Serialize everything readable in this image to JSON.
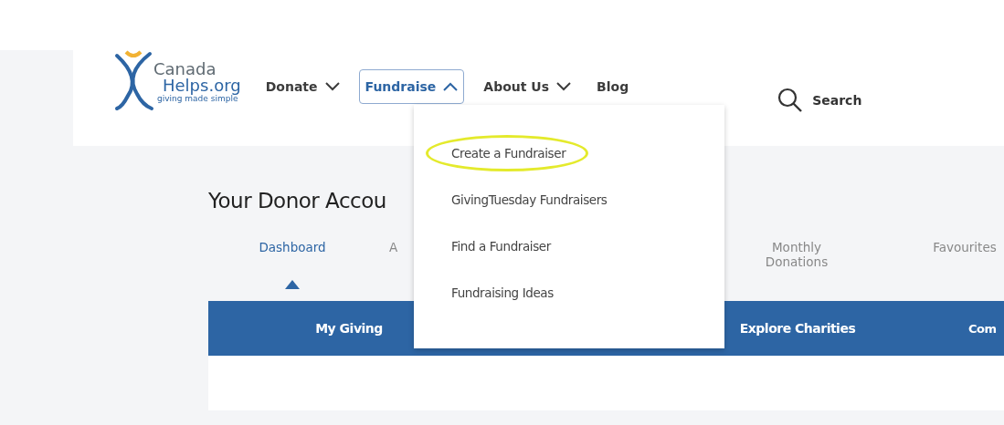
{
  "logo": {
    "line_1": "Canada",
    "line_2": "Helps.org",
    "tagline": "giving made simple"
  },
  "nav": [
    {
      "label": "Donate",
      "expanded": false,
      "has_menu": true
    },
    {
      "label": "Fundraise",
      "expanded": true,
      "has_menu": true
    },
    {
      "label": "About Us",
      "expanded": false,
      "has_menu": true
    },
    {
      "label": "Blog",
      "expanded": false,
      "has_menu": false
    }
  ],
  "search": {
    "label": "Search"
  },
  "dropdown": {
    "items": [
      {
        "label": "Create a Fundraiser",
        "circled": true
      },
      {
        "label": "GivingTuesday Fundraisers",
        "circled": false
      },
      {
        "label": "Find a Fundraiser",
        "circled": false
      },
      {
        "label": "Fundraising Ideas",
        "circled": false
      }
    ]
  },
  "page_title": "Your Donor Accou",
  "tabs": [
    {
      "label": "Dashboard",
      "selected": true
    },
    {
      "label": "A",
      "selected": false
    },
    {
      "label": "Monthly Donations",
      "selected": false
    },
    {
      "label": "Favourites",
      "selected": false
    }
  ],
  "subnav": [
    "My Giving",
    "Explore Charities",
    "Com"
  ]
}
